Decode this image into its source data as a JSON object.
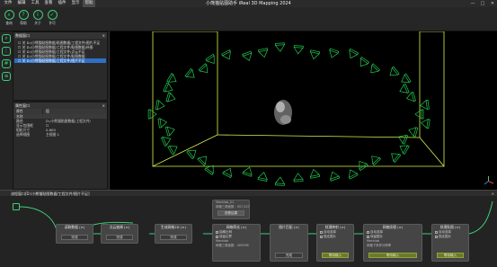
{
  "menu": [
    "文件",
    "编辑",
    "工具",
    "查看",
    "插件",
    "显示",
    "帮助"
  ],
  "menu_active_index": 6,
  "app_title": "小熊猫贴图助手 iReal 3D Mapping 2024",
  "window_controls": [
    "—",
    "□",
    "✕"
  ],
  "toolbar": [
    {
      "label": "查询",
      "icon": "search-icon"
    },
    {
      "label": "帮助",
      "icon": "help-icon"
    },
    {
      "label": "关于",
      "icon": "info-icon"
    },
    {
      "label": "许可",
      "icon": "license-icon"
    }
  ],
  "tree_panel": {
    "title": "数据窗口",
    "rows": [
      {
        "label": "☐ 关 D:/小熊猫贴图数据/贴图数据/工程文件/图片不足",
        "selected": false
      },
      {
        "label": "☐ 关 D:/小熊猫贴图数据/工程文件/贴图数据/补图",
        "selected": false
      },
      {
        "label": "☐ 关 D:/小熊猫贴图数据/工程文件/点云不足",
        "selected": false
      },
      {
        "label": "☐ 关 D:/小熊猫贴图数据/工程文件/贴图数据",
        "selected": false
      },
      {
        "label": "☐ 关 D:/小熊猫贴图数据/工程文件/图片不足",
        "selected": true
      }
    ]
  },
  "props_panel": {
    "title": "属性窗口",
    "col_key": "属性",
    "col_value": "值",
    "rows": [
      {
        "k": "名称",
        "v": "",
        "hl": true
      },
      {
        "k": "路径",
        "v": "D:/小熊猫贴图数据/工程文件/",
        "hl": false
      },
      {
        "k": "显示包围框",
        "v": "☐",
        "hl": false
      },
      {
        "k": "相机尺寸",
        "v": "0.800",
        "hl": false
      },
      {
        "k": "选择视图",
        "v": "主视图 1",
        "hl": false
      }
    ]
  },
  "flow_panel": {
    "title": "流程窗口[D:/小熊猫贴图数据/工程文件/图片不足]",
    "close": "×"
  },
  "nodes": [
    {
      "title": "读取数据 (×)",
      "btn": "完成"
    },
    {
      "title": "点云抽稀 (×)",
      "btn": "完成"
    },
    {
      "title": "生成网格2D (×)",
      "btn": "完成"
    },
    {
      "title": "网格简化 (×)",
      "opt1": "抽稀比例",
      "opt2": "保留边界",
      "note1": "Meshlab",
      "note2": "网格三角面数：409296",
      "btn": "完成"
    },
    {
      "title": "图片匹配 (×)",
      "btn": "完成"
    },
    {
      "title": "纹理映射 (×)",
      "opt1": "自动选择",
      "opt2": "指定图片",
      "btn": "等待输入"
    },
    {
      "title": "网格纹理 (×)",
      "opt1": "自动选择",
      "opt2": "保留图片",
      "note1": "Meshlab",
      "note2": "网格下采样分辨率",
      "btn": "等待输入"
    },
    {
      "title": "纹理贴图 (×)",
      "opt1": "自动选择",
      "opt2": "指定图片",
      "btn": "等待输入"
    }
  ],
  "floating_node": {
    "line1": "Meshlab_01",
    "line2": "网格三角面数：557,327",
    "btn": "查看结果"
  },
  "colors": {
    "accent": "#3ecf7a",
    "selected": "#2f6ec4",
    "box": "#d9f24a",
    "cams": "#21c94f"
  }
}
